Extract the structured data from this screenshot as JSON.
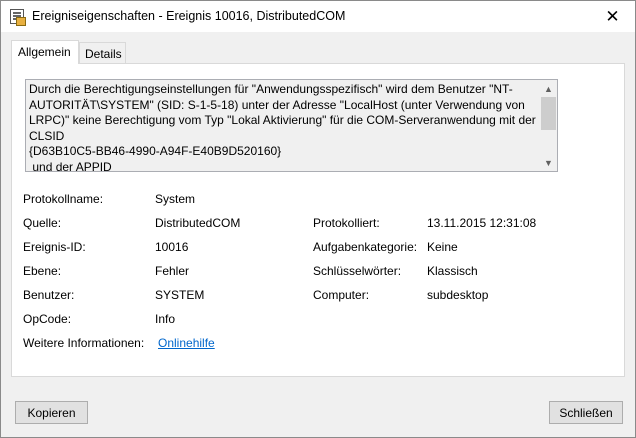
{
  "window": {
    "title": "Ereigniseigenschaften - Ereignis 10016, DistributedCOM",
    "close_glyph": "✕",
    "icon": "event-viewer-icon"
  },
  "tabs": [
    {
      "label": "Allgemein",
      "active": true
    },
    {
      "label": "Details",
      "active": false
    }
  ],
  "description": {
    "text": "Durch die Berechtigungseinstellungen für \"Anwendungsspezifisch\" wird dem Benutzer \"NT-AUTORITÄT\\SYSTEM\" (SID: S-1-5-18) unter der Adresse \"LocalHost (unter Verwendung von LRPC)\" keine Berechtigung vom Typ \"Lokal Aktivierung\" für die COM-Serveranwendung mit der CLSID\n{D63B10C5-BB46-4990-A94F-E40B9D520160}\n und der APPID"
  },
  "fields": {
    "protokollname": {
      "label": "Protokollname:",
      "value": "System"
    },
    "quelle": {
      "label": "Quelle:",
      "value": "DistributedCOM"
    },
    "protokolliert": {
      "label": "Protokolliert:",
      "value": "13.11.2015 12:31:08"
    },
    "ereignis_id": {
      "label": "Ereignis-ID:",
      "value": "10016"
    },
    "aufgabenkategorie": {
      "label": "Aufgabenkategorie:",
      "value": "Keine"
    },
    "ebene": {
      "label": "Ebene:",
      "value": "Fehler"
    },
    "schluesselwoerter": {
      "label": "Schlüsselwörter:",
      "value": "Klassisch"
    },
    "benutzer": {
      "label": "Benutzer:",
      "value": "SYSTEM"
    },
    "computer": {
      "label": "Computer:",
      "value": "subdesktop"
    },
    "opcode": {
      "label": "OpCode:",
      "value": "Info"
    },
    "weitere_info": {
      "label": "Weitere Informationen:",
      "value": "Onlinehilfe"
    }
  },
  "buttons": {
    "copy": "Kopieren",
    "close": "Schließen"
  },
  "icons": {
    "nav_up": "arrow-up-icon",
    "nav_down": "arrow-down-icon"
  }
}
